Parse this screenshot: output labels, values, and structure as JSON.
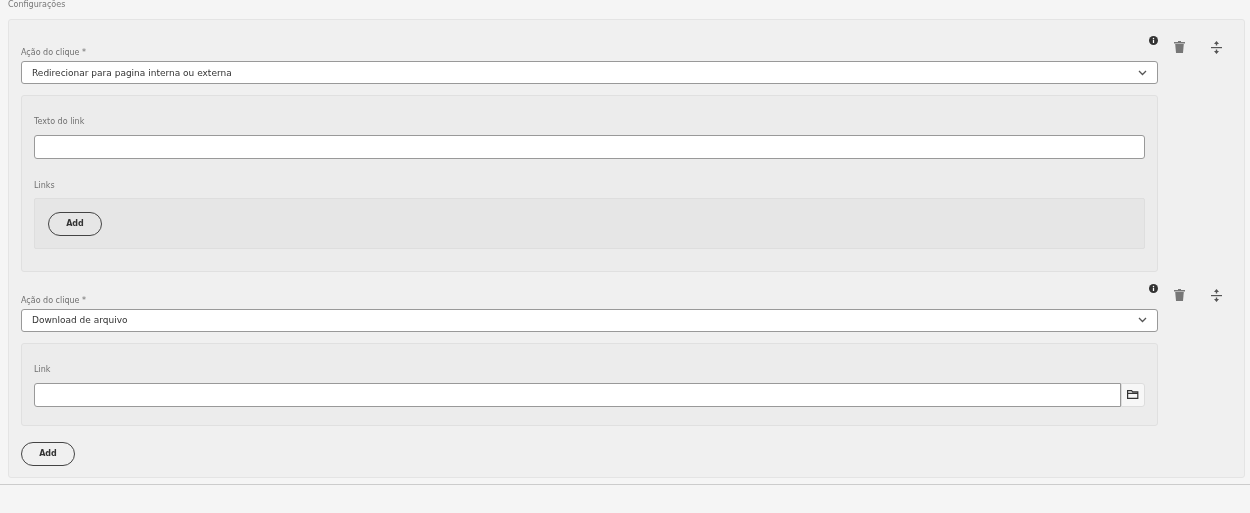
{
  "section_title": "Configurações",
  "items": [
    {
      "kind": "links",
      "label": "Ação do clique *",
      "value": "Redirecionar para pagina interna ou externa",
      "text_label": "Texto do link",
      "links_label": "Links",
      "add_button": "Add"
    },
    {
      "kind": "file",
      "label": "Ação do clique *",
      "value": "Download de arquivo",
      "link_label": "Link"
    }
  ],
  "add_button": "Add"
}
